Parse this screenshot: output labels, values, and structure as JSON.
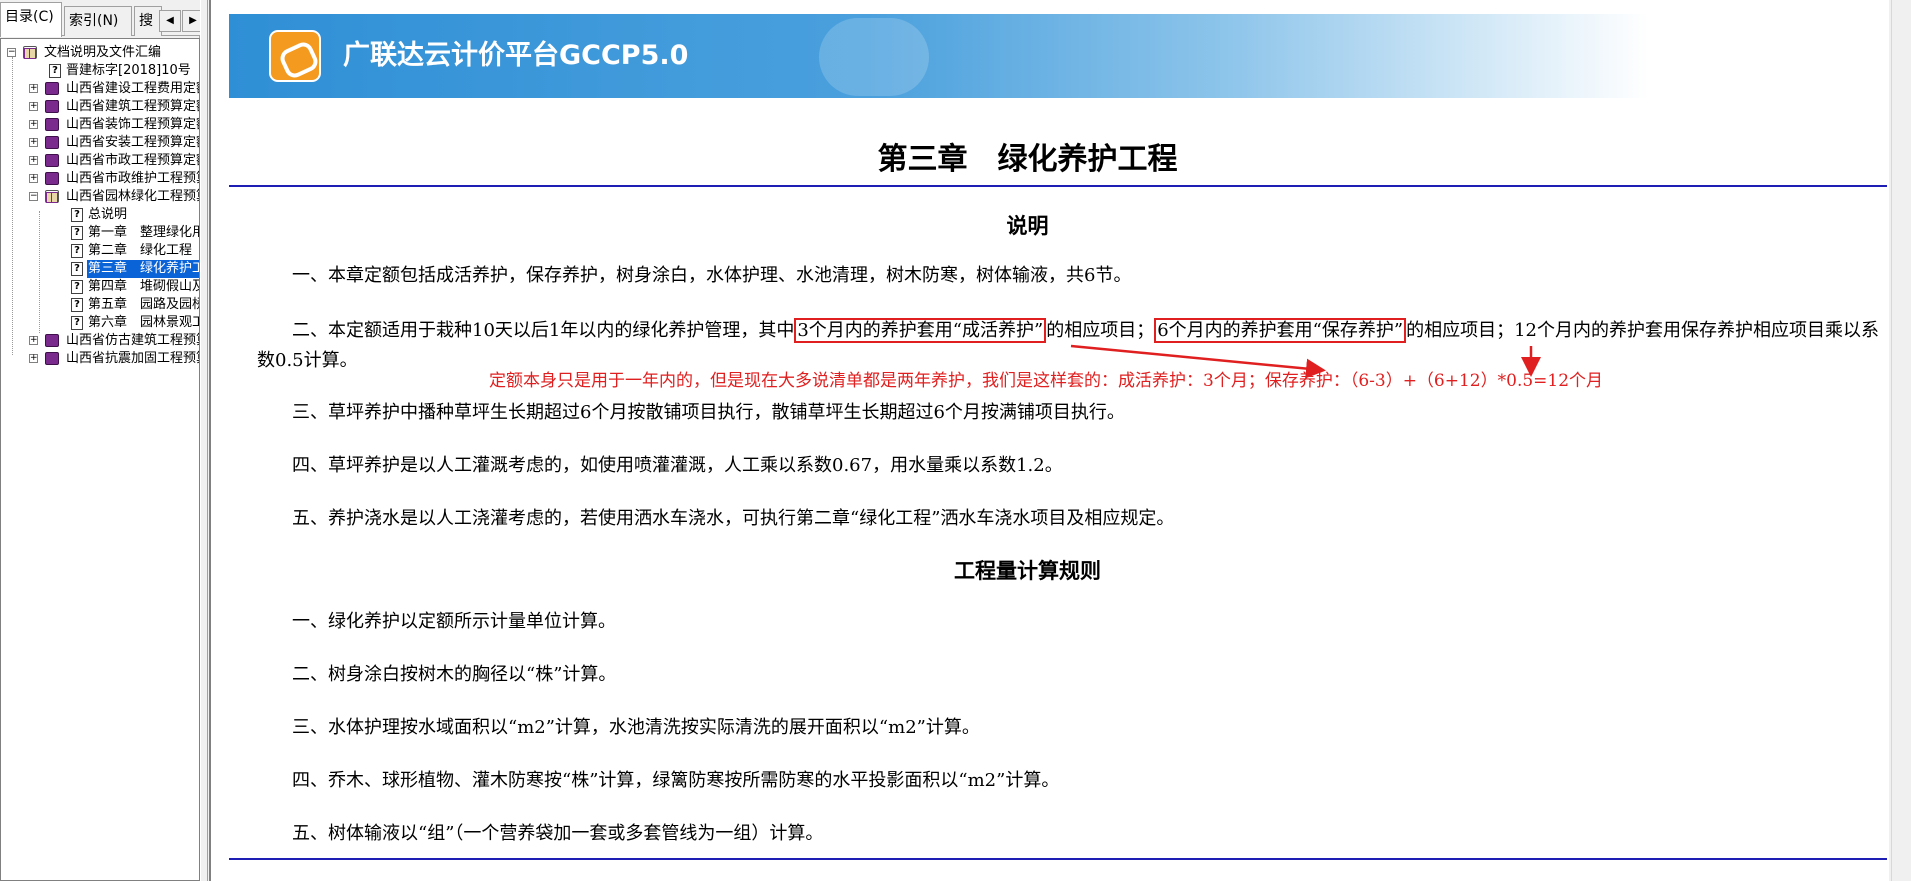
{
  "tabs": {
    "contents": "目录(C)",
    "index": "索引(N)",
    "search": "搜",
    "scroll_left": "◀",
    "scroll_right": "▶"
  },
  "tree": {
    "root": "文档说明及文件汇编",
    "doc_item": "晋建标字[2018]10号",
    "books": [
      "山西省建设工程费用定额",
      "山西省建筑工程预算定额",
      "山西省装饰工程预算定额",
      "山西省安装工程预算定额",
      "山西省市政工程预算定额",
      "山西省市政维护工程预算定额"
    ],
    "open_book": "山西省园林绿化工程预算定额",
    "chapters": [
      "总说明",
      "第一章　整理绿化用地",
      "第二章　绿化工程",
      "第三章　绿化养护工程",
      "第四章　堆砌假山及塑假石山工程",
      "第五章　园路及园桥工程",
      "第六章　园林景观工程"
    ],
    "books_after": [
      "山西省仿古建筑工程预算定额",
      "山西省抗震加固工程预算定额"
    ]
  },
  "banner": {
    "title": "广联达云计价平台GCCP5.0"
  },
  "document": {
    "chapter_title": "第三章　绿化养护工程",
    "heading_notes": "说明",
    "p1": "一、本章定额包括成活养护，保存养护，树身涂白，水体护理、水池清理，树木防寒，树体输液，共6节。",
    "p2_before": "二、本定额适用于栽种10天以后1年以内的绿化养护管理，其中",
    "p2_box1": "3个月内的养护套用“成活养护”",
    "p2_mid": "的相应项目；",
    "p2_box2": "6个月内的养护套用“保存养护”",
    "p2_after": "的相应项目；12个月内的养护套用保存养护相应项目乘以系数0.5计算。",
    "annotation": "定额本身只是用于一年内的，但是现在大多说清单都是两年养护，我们是这样套的：成活养护：3个月；保存养护：（6-3）+（6+12）*0.5=12个月",
    "p3": "三、草坪养护中播种草坪生长期超过6个月按散铺项目执行，散铺草坪生长期超过6个月按满铺项目执行。",
    "p4": "四、草坪养护是以人工灌溉考虑的，如使用喷灌灌溉，人工乘以系数0.67，用水量乘以系数1.2。",
    "p5": "五、养护浇水是以人工浇灌考虑的，若使用洒水车浇水，可执行第二章“绿化工程”洒水车浇水项目及相应规定。",
    "heading_rules": "工程量计算规则",
    "r1": "一、绿化养护以定额所示计量单位计算。",
    "r2": "二、树身涂白按树木的胸径以“株”计算。",
    "r3": "三、水体护理按水域面积以“m2”计算，水池清洗按实际清洗的展开面积以“m2”计算。",
    "r4": "四、乔木、球形植物、灌木防寒按“株”计算，绿篱防寒按所需防寒的水平投影面积以“m2”计算。",
    "r5": "五、树体输液以“组”（一个营养袋加一套或多套管线为一组）计算。"
  },
  "colors": {
    "rule_line": "#1e1eb4",
    "highlight": "#e02020",
    "selection": "#0a64d8",
    "banner": "#2f8fd6",
    "logo": "#f39a1f"
  }
}
